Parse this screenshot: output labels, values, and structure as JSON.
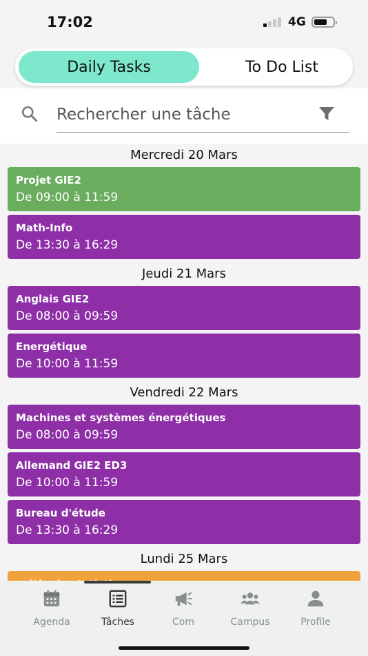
{
  "status": {
    "time": "17:02",
    "network": "4G"
  },
  "tabs": {
    "active_label": "Daily Tasks",
    "inactive_label": "To Do List"
  },
  "search": {
    "placeholder": "Rechercher une tâche"
  },
  "colors": {
    "green": "#6aad5e",
    "purple": "#8e2fa8",
    "orange": "#f0a33b",
    "accent": "#7ee8cc"
  },
  "days": [
    {
      "label": "Mercredi 20 Mars",
      "tasks": [
        {
          "title": "Projet GIE2",
          "time": "De 09:00 à 11:59",
          "color": "green"
        },
        {
          "title": "Math-Info",
          "time": "De 13:30 à 16:29",
          "color": "purple"
        }
      ]
    },
    {
      "label": "Jeudi 21 Mars",
      "tasks": [
        {
          "title": "Anglais GIE2",
          "time": "De 08:00 à 09:59",
          "color": "purple"
        },
        {
          "title": "Energétique",
          "time": "De 10:00 à 11:59",
          "color": "purple"
        }
      ]
    },
    {
      "label": "Vendredi 22 Mars",
      "tasks": [
        {
          "title": "Machines et systèmes énergétiques",
          "time": "De 08:00 à 09:59",
          "color": "purple"
        },
        {
          "title": "Allemand GIE2 ED3",
          "time": "De 10:00 à 11:59",
          "color": "purple"
        },
        {
          "title": "Bureau d'étude",
          "time": "De 13:30 à 16:29",
          "color": "purple"
        }
      ]
    },
    {
      "label": "Lundi 25 Mars",
      "tasks": [
        {
          "title": "méthode statistique processus",
          "time": "",
          "color": "orange"
        }
      ]
    }
  ],
  "nav": [
    {
      "label": "Agenda",
      "icon": "calendar-icon",
      "active": false
    },
    {
      "label": "Tâches",
      "icon": "list-icon",
      "active": true
    },
    {
      "label": "Com",
      "icon": "megaphone-icon",
      "active": false
    },
    {
      "label": "Campus",
      "icon": "people-icon",
      "active": false
    },
    {
      "label": "Profile",
      "icon": "person-icon",
      "active": false
    }
  ]
}
